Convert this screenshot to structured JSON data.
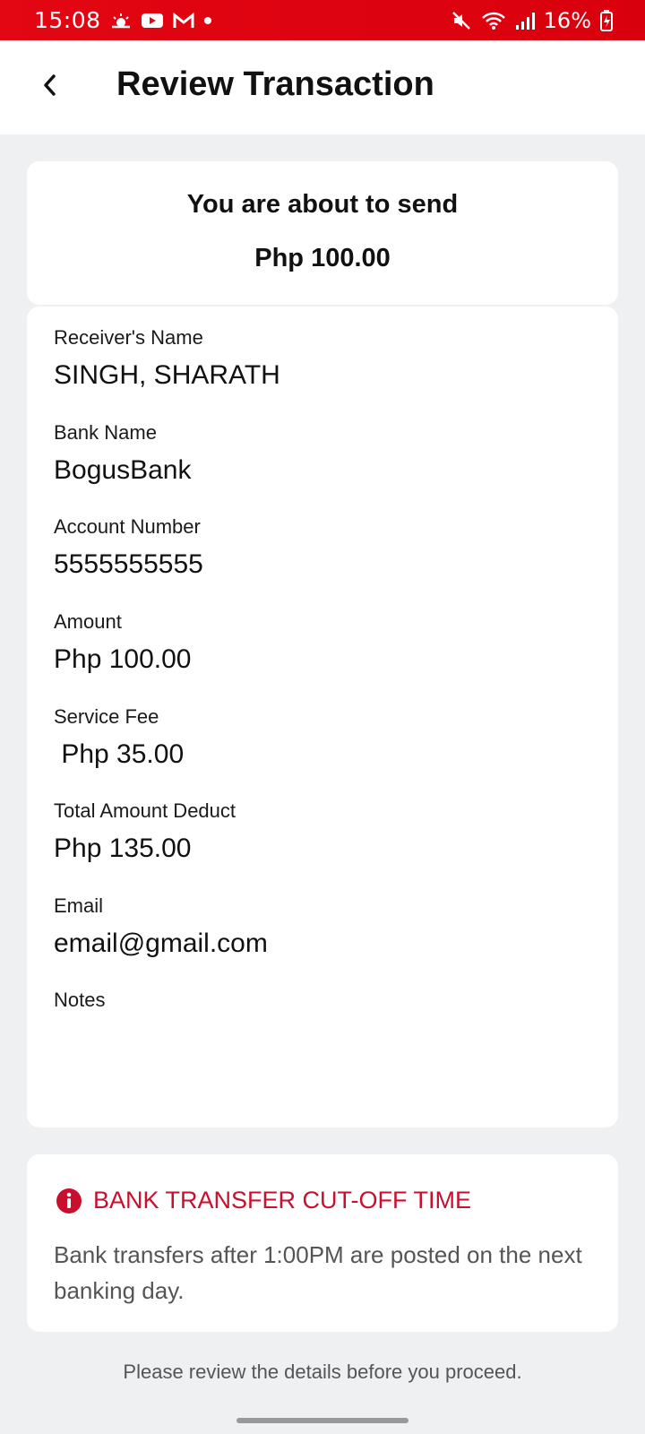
{
  "status_bar": {
    "time": "15:08",
    "battery": "16%",
    "notification_icons": [
      "weather-icon",
      "youtube-icon",
      "gmail-icon",
      "dot-icon"
    ],
    "system_icons": [
      "mute-icon",
      "wifi-icon",
      "signal-icon",
      "battery-charging-icon"
    ],
    "background_color": "#e30613"
  },
  "header": {
    "title": "Review Transaction"
  },
  "summary": {
    "heading": "You are about to send",
    "amount": "Php 100.00"
  },
  "details": {
    "receiver_name_label": "Receiver's Name",
    "receiver_name_value": "SINGH, SHARATH",
    "bank_name_label": "Bank Name",
    "bank_name_value": "BogusBank",
    "account_number_label": "Account Number",
    "account_number_value": "5555555555",
    "amount_label": "Amount",
    "amount_value": "Php 100.00",
    "service_fee_label": "Service Fee",
    "service_fee_value": " Php 35.00",
    "total_label": "Total Amount Deduct",
    "total_value": "Php 135.00",
    "email_label": "Email",
    "email_value": "email@gmail.com",
    "notes_label": "Notes",
    "notes_value": ""
  },
  "notice": {
    "title": "BANK TRANSFER CUT-OFF TIME",
    "body": "Bank transfers after 1:00PM are posted on the next banking day.",
    "accent_color": "#c8102e"
  },
  "footer": {
    "note": "Please review the details before you proceed."
  }
}
